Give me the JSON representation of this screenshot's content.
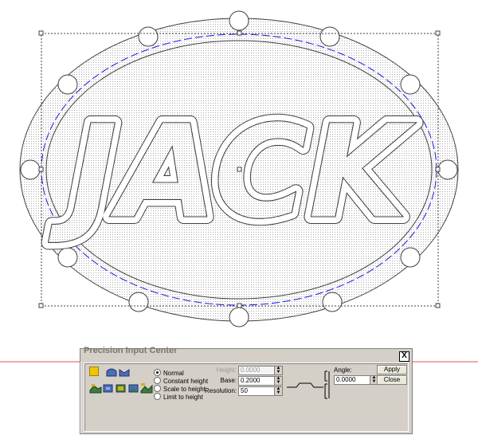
{
  "artwork": {
    "text": "JACK",
    "hole_count": 12
  },
  "dialog": {
    "title": "Precision Input Center",
    "close_label": "X",
    "mode_options": [
      {
        "label": "Normal",
        "selected": true
      },
      {
        "label": "Constant height",
        "selected": false
      },
      {
        "label": "Scale to height",
        "selected": false
      },
      {
        "label": "Limit to height",
        "selected": false
      }
    ],
    "height_label": "Height:",
    "height_value": "0.0000",
    "base_label": "Base:",
    "base_value": "0.2000",
    "resolution_label": "Resolution:",
    "resolution_value": "50",
    "angle_label": "Angle:",
    "angle_value": "0.0000",
    "apply_label": "Apply",
    "close_button_label": "Close"
  },
  "colors": {
    "accent": "#1a1adf",
    "guide_line": "#e05050",
    "panel": "#d4d0c8"
  }
}
